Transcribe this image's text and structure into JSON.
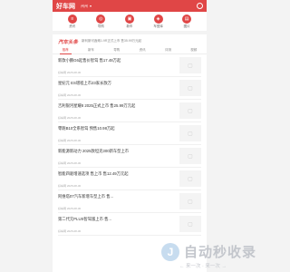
{
  "header": {
    "logo_text": "好车网",
    "location": "州州",
    "location_chevron": "▾",
    "user_icon": "user-icon",
    "accent": "#e04646"
  },
  "categories": [
    {
      "label": "资讯",
      "icon": "news-icon",
      "glyph": "≡"
    },
    {
      "label": "导购",
      "icon": "guide-icon",
      "glyph": "◎"
    },
    {
      "label": "新车",
      "icon": "car-icon",
      "glyph": "▣"
    },
    {
      "label": "车型库",
      "icon": "model-icon",
      "glyph": "◈"
    },
    {
      "label": "图片",
      "icon": "image-icon",
      "glyph": "▤"
    }
  ],
  "headline": {
    "brand": "汽车头条",
    "text": "新利斯可鑫蛛1.9R正式上市 售35.99万元起"
  },
  "tabs": [
    {
      "label": "推荐",
      "active": true
    },
    {
      "label": "新车"
    },
    {
      "label": "导购"
    },
    {
      "label": "资讯"
    },
    {
      "label": "评测"
    },
    {
      "label": "视频"
    }
  ],
  "articles": [
    {
      "title": "新款小鹏G6起售价智驾 售17.48万起",
      "meta": "好车网   2025-08-30"
    },
    {
      "title": "星纪元 ES增程上市23家长款万",
      "meta": "好车网   2025-08-30"
    },
    {
      "title": "吉利银河星耀8 2025正式上市 售25.99万元起",
      "meta": "好车网   2025-08-30"
    },
    {
      "title": "零跑B10全系智驾 预售10.98万起",
      "meta": "好车网   2025-08-30"
    },
    {
      "title": "新能源新动力 2025款坦克300新车型上市",
      "meta": "好车网   2025-08-30"
    },
    {
      "title": "智能四驱增速选项 售上市 售12.49万元起",
      "meta": "好车网   2025-08-30"
    },
    {
      "title": "阿维塔07汽车新增车型上市 售...",
      "meta": "好车网   2025-08-30"
    },
    {
      "title": "第二代元PLUS智驾版上市 售...",
      "meta": "好车网   2025-08-30"
    }
  ],
  "watermark": {
    "title": "自动秒收录",
    "subtitle": "← 来一次 · 来一次 →"
  }
}
